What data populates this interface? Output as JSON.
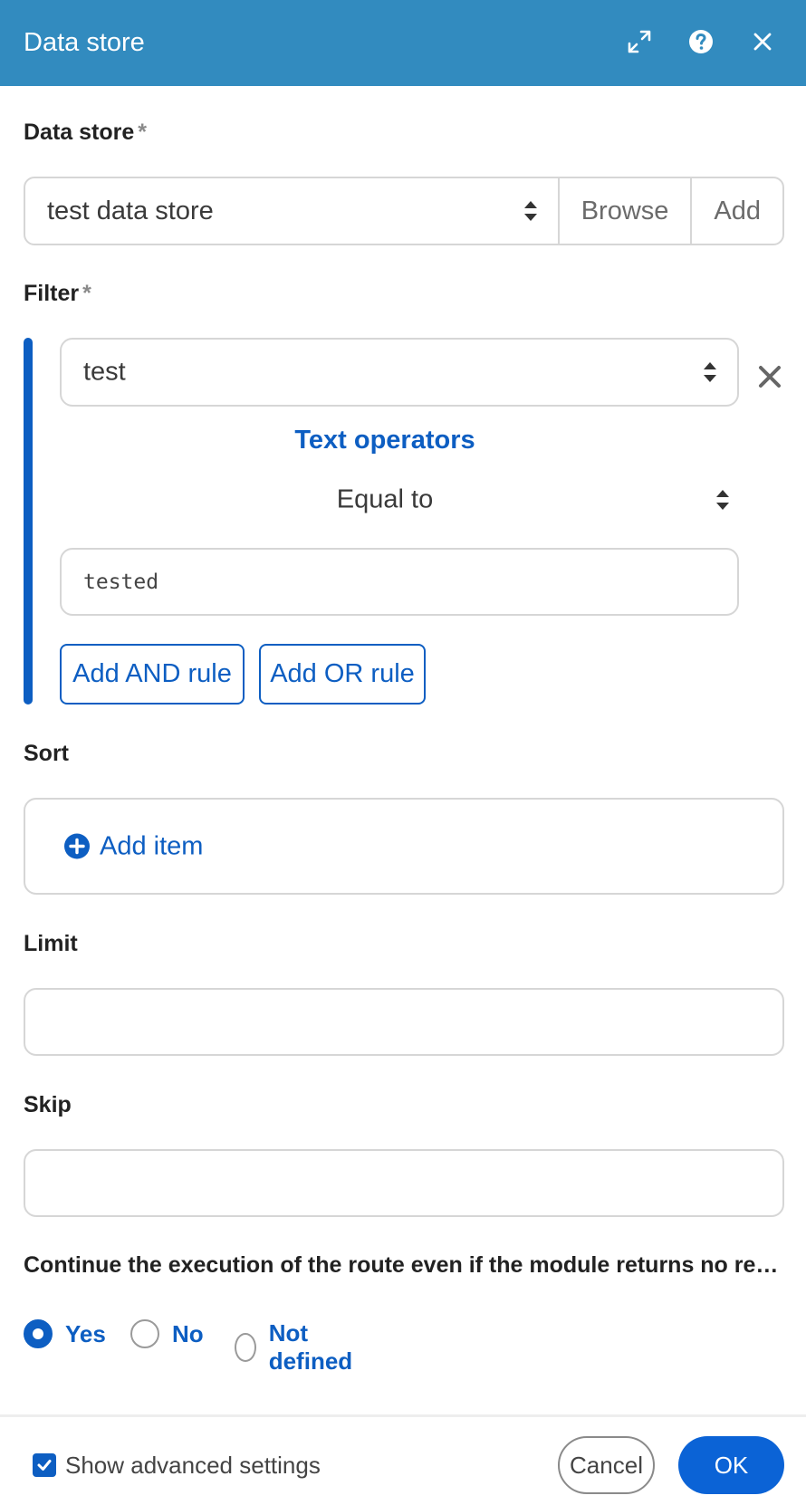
{
  "header": {
    "title": "Data store",
    "icons": [
      "expand-icon",
      "help-icon",
      "close-icon"
    ],
    "background": "#328bbf"
  },
  "data_store": {
    "label": "Data store",
    "required_mark": "*",
    "value": "test data store",
    "browse_label": "Browse",
    "add_label": "Add"
  },
  "filter": {
    "label": "Filter",
    "required_mark": "*",
    "field_value": "test",
    "operators_heading": "Text operators",
    "operator": "Equal to",
    "comparison_value": "tested",
    "add_and_label": "Add AND rule",
    "add_or_label": "Add OR rule"
  },
  "sort": {
    "label": "Sort",
    "add_item_label": "Add item"
  },
  "limit": {
    "label": "Limit",
    "value": ""
  },
  "skip": {
    "label": "Skip",
    "value": ""
  },
  "continue": {
    "label": "Continue the execution of the route even if the module returns no results",
    "options": [
      "Yes",
      "No",
      "Not defined"
    ],
    "selected": "Yes"
  },
  "footer": {
    "show_advanced_label": "Show advanced settings",
    "show_advanced_checked": true,
    "cancel_label": "Cancel",
    "ok_label": "OK"
  },
  "colors": {
    "accent": "#0d5ec2",
    "ok_button": "#0b63d6"
  }
}
